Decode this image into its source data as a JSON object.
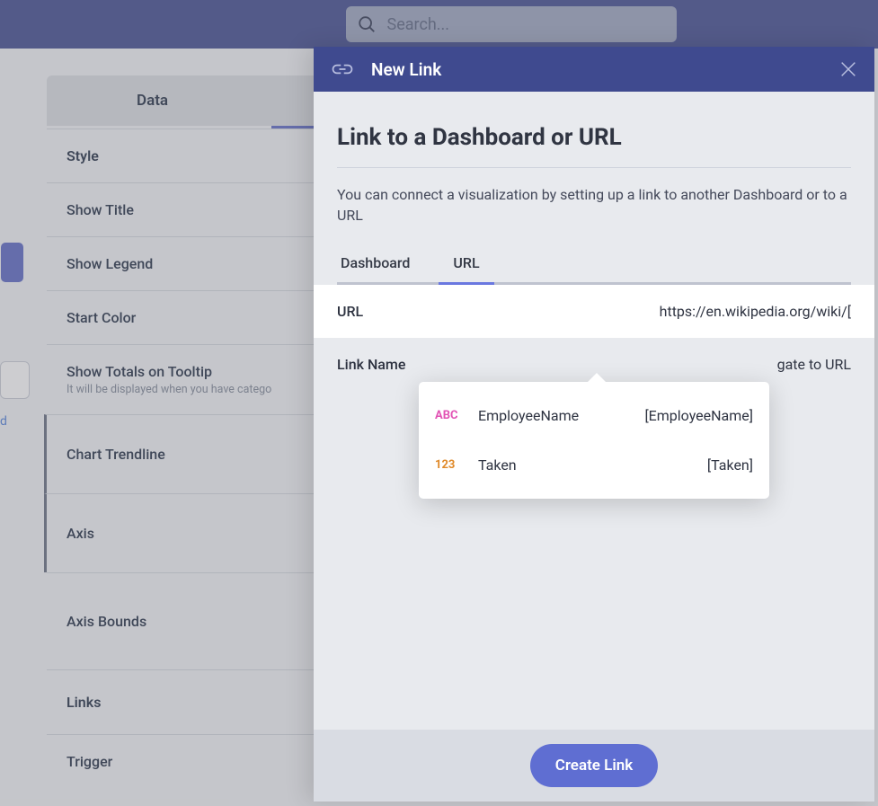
{
  "search": {
    "placeholder": "Search..."
  },
  "sidebar": {
    "tab_label": "Data",
    "rows": {
      "style": "Style",
      "show_title": "Show Title",
      "show_legend": "Show Legend",
      "start_color": "Start Color",
      "totals_title": "Show Totals on Tooltip",
      "totals_sub": "It will be displayed when you have catego",
      "trendline": "Chart Trendline",
      "axis": "Axis",
      "axis_bounds": "Axis Bounds",
      "links": "Links",
      "trigger": "Trigger"
    },
    "fragment_d": "d"
  },
  "modal": {
    "header_title": "New Link",
    "h1": "Link to a Dashboard or URL",
    "desc": "You can connect a visualization by setting up a link to another Dashboard or to a URL",
    "tabs": {
      "dashboard": "Dashboard",
      "url": "URL"
    },
    "url_row": {
      "label": "URL",
      "value": "https://en.wikipedia.org/wiki/["
    },
    "linkname_row": {
      "label": "Link Name",
      "value_suffix": "gate to URL"
    },
    "create_btn": "Create Link"
  },
  "dropdown": {
    "items": [
      {
        "type_icon": "ABC",
        "type_class": "abc",
        "name": "EmployeeName",
        "token": "[EmployeeName]"
      },
      {
        "type_icon": "123",
        "type_class": "num",
        "name": "Taken",
        "token": "[Taken]"
      }
    ]
  }
}
